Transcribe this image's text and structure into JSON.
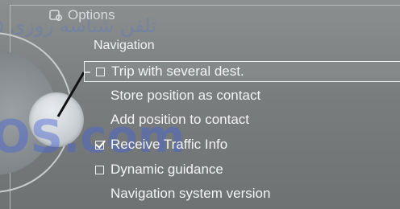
{
  "header": {
    "title": "Options",
    "icon": "options-settings-icon"
  },
  "section_title": "Navigation",
  "menu": {
    "items": [
      {
        "label": "Trip with several dest.",
        "checkbox": true,
        "checked": false,
        "selected": true
      },
      {
        "label": "Store position as contact",
        "checkbox": false
      },
      {
        "label": "Add position to contact",
        "checkbox": false
      },
      {
        "label": "Receive Traffic Info",
        "checkbox": true,
        "checked": true
      },
      {
        "label": "Dynamic guidance",
        "checkbox": true,
        "checked": false
      },
      {
        "label": "Navigation system version",
        "checkbox": false
      }
    ]
  },
  "watermark": {
    "persian": "تلفن شناسه روزی ۵",
    "latin": "OS.com"
  }
}
